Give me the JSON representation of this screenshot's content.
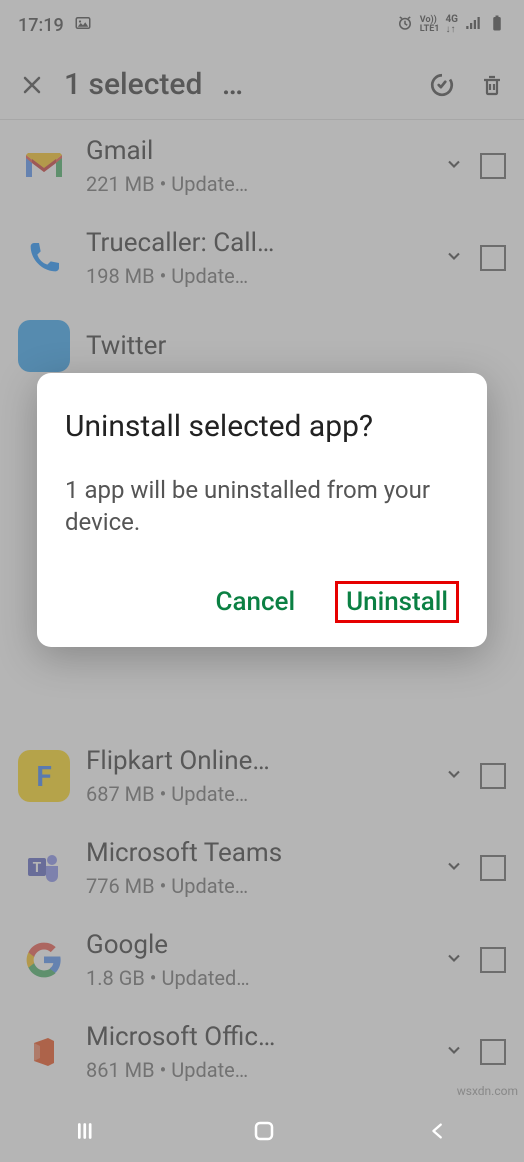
{
  "status": {
    "time": "17:19"
  },
  "header": {
    "title": "1 selected",
    "overflow": "…"
  },
  "apps": [
    {
      "name": "Gmail",
      "sub": "221 MB  •  Update…"
    },
    {
      "name": "Truecaller: Call…",
      "sub": "198 MB  •  Update…"
    },
    {
      "name": "Twitter",
      "sub": ""
    },
    {
      "name": "Flipkart Online…",
      "sub": "687 MB  •  Update…"
    },
    {
      "name": "Microsoft Teams",
      "sub": "776 MB  •  Update…"
    },
    {
      "name": "Google",
      "sub": "1.8 GB  •  Updated…"
    },
    {
      "name": "Microsoft Offic…",
      "sub": "861 MB  •  Update…"
    }
  ],
  "dialog": {
    "title": "Uninstall selected app?",
    "message": "1 app will be uninstalled from your device.",
    "cancel": "Cancel",
    "confirm": "Uninstall"
  },
  "watermark": "wsxdn.com"
}
